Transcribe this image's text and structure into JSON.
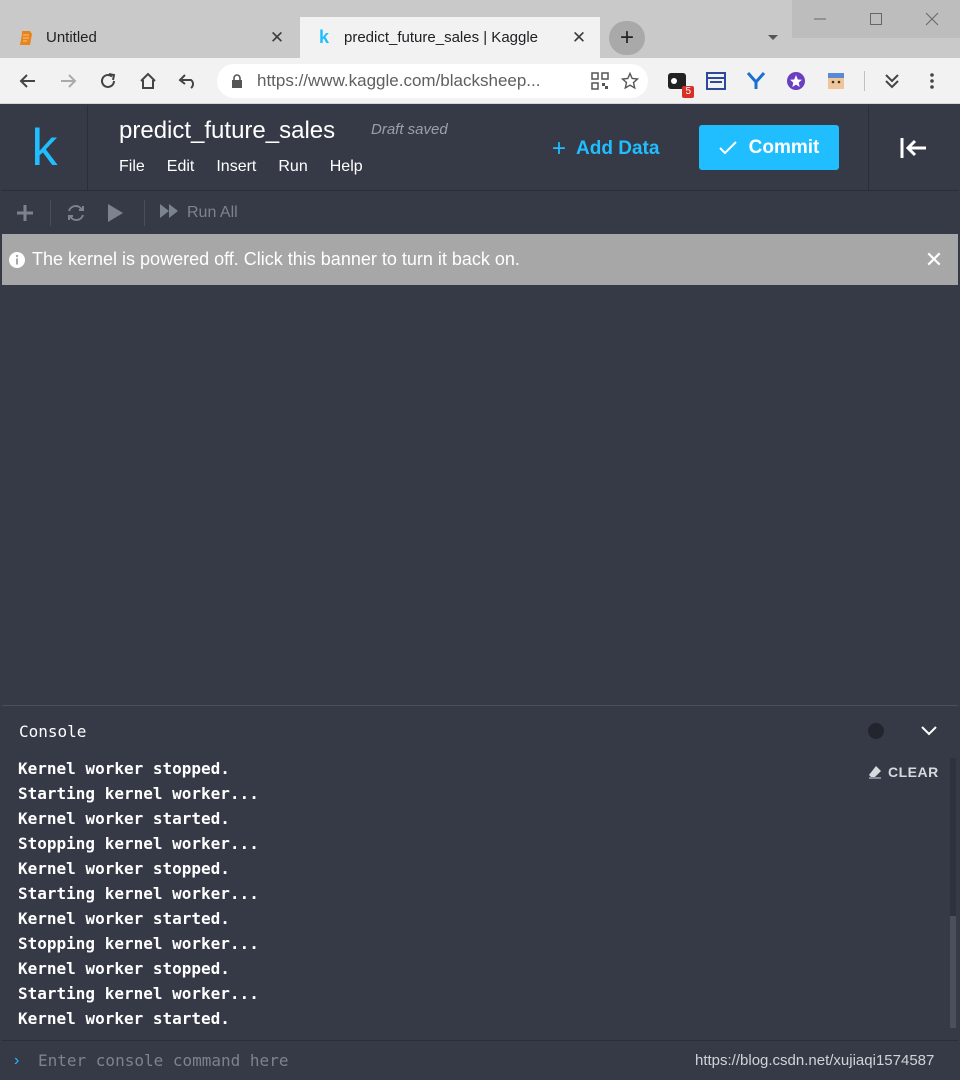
{
  "browser": {
    "tabs": [
      {
        "title": "Untitled",
        "icon": "document-icon",
        "active": false
      },
      {
        "title": "predict_future_sales | Kaggle",
        "icon": "kaggle-k-icon",
        "active": true
      }
    ],
    "tab_close_glyph": "✕",
    "new_tab_glyph": "+",
    "url": "https://www.kaggle.com/blacksheep...",
    "extension_badge": "5"
  },
  "kaggle": {
    "logo_letter": "k",
    "notebook_title": "predict_future_sales",
    "save_status": "Draft saved",
    "menu": [
      "File",
      "Edit",
      "Insert",
      "Run",
      "Help"
    ],
    "add_data_plus": "+",
    "add_data_label": "Add Data",
    "commit_label": "Commit",
    "accent_color": "#20beff"
  },
  "notebook_toolbar": {
    "run_all_label": "Run All"
  },
  "banner": {
    "message": "The kernel is powered off. Click this banner to turn it back on.",
    "close_glyph": "✕"
  },
  "console": {
    "title": "Console",
    "clear_label": "CLEAR",
    "lines": [
      "Kernel worker stopped.",
      "Starting kernel worker...",
      "Kernel worker started.",
      "Stopping kernel worker...",
      "Kernel worker stopped.",
      "Starting kernel worker...",
      "Kernel worker started.",
      "Stopping kernel worker...",
      "Kernel worker stopped.",
      "Starting kernel worker...",
      "Kernel worker started."
    ],
    "input_placeholder": "Enter console command here",
    "prompt_glyph": "›"
  },
  "watermark": "https://blog.csdn.net/xujiaqi1574587"
}
